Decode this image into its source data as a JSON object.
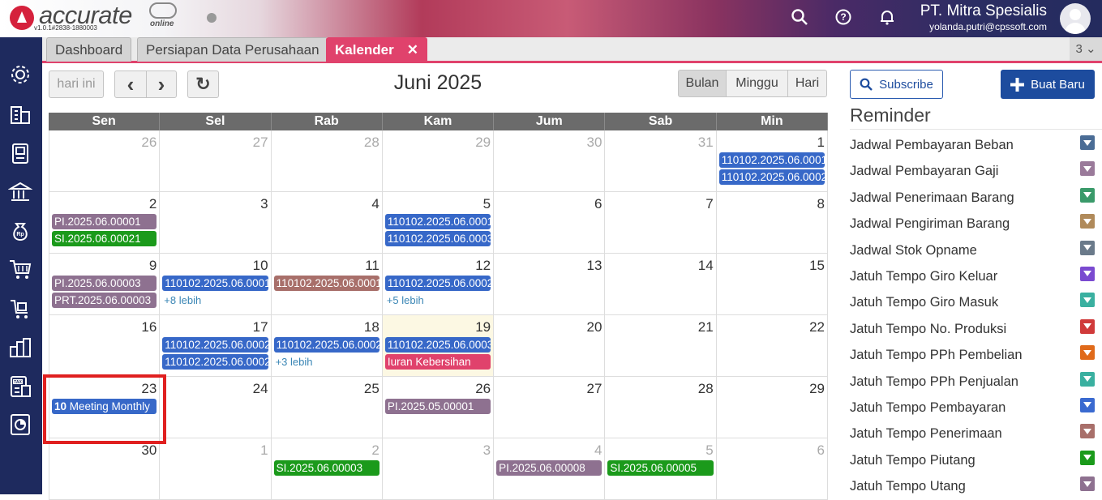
{
  "app": {
    "brand": "accurate",
    "brand_sub": "online",
    "version": "v1.0.1#2838-1880003",
    "company": "PT. Mitra Spesialis",
    "user_email": "yolanda.putri@cpssoft.com",
    "icons": [
      "search-icon",
      "help-icon",
      "bell-icon"
    ]
  },
  "tabs": [
    {
      "label": "Dashboard"
    },
    {
      "label": "Persiapan Data Perusahaan"
    },
    {
      "label": "Kalender",
      "close": "✕"
    }
  ],
  "tab_count": "3 ⌄",
  "toolbar": {
    "today": "hari ini",
    "prev": "‹",
    "next": "›",
    "refresh": "↻",
    "month_title": "Juni 2025",
    "views": [
      "Bulan",
      "Minggu",
      "Hari"
    ],
    "subscribe": "Subscribe",
    "new": "Buat Baru"
  },
  "calendar": {
    "weekdays": [
      "Sen",
      "Sel",
      "Rab",
      "Kam",
      "Jum",
      "Sab",
      "Min"
    ],
    "weeks": [
      [
        {
          "d": "26",
          "other": true,
          "events": []
        },
        {
          "d": "27",
          "other": true,
          "events": []
        },
        {
          "d": "28",
          "other": true,
          "events": []
        },
        {
          "d": "29",
          "other": true,
          "events": []
        },
        {
          "d": "30",
          "other": true,
          "events": []
        },
        {
          "d": "31",
          "other": true,
          "events": []
        },
        {
          "d": "1",
          "events": [
            {
              "t": "110102.2025.06.0001",
              "c": "blue"
            },
            {
              "t": "110102.2025.06.0002",
              "c": "blue"
            }
          ]
        }
      ],
      [
        {
          "d": "2",
          "events": [
            {
              "t": "PI.2025.06.00001",
              "c": "purple"
            },
            {
              "t": "SI.2025.06.00021",
              "c": "green"
            }
          ]
        },
        {
          "d": "3",
          "events": []
        },
        {
          "d": "4",
          "events": []
        },
        {
          "d": "5",
          "events": [
            {
              "t": "110102.2025.06.0001",
              "c": "blue"
            },
            {
              "t": "110102.2025.06.0003",
              "c": "blue"
            }
          ]
        },
        {
          "d": "6",
          "events": []
        },
        {
          "d": "7",
          "events": []
        },
        {
          "d": "8",
          "events": []
        }
      ],
      [
        {
          "d": "9",
          "events": [
            {
              "t": "PI.2025.06.00003",
              "c": "purple"
            },
            {
              "t": "PRT.2025.06.00003",
              "c": "purple"
            }
          ]
        },
        {
          "d": "10",
          "events": [
            {
              "t": "110102.2025.06.0001",
              "c": "blue"
            }
          ],
          "more": "+8 lebih"
        },
        {
          "d": "11",
          "events": [
            {
              "t": "110102.2025.06.0001",
              "c": "brown"
            }
          ]
        },
        {
          "d": "12",
          "events": [
            {
              "t": "110102.2025.06.0002",
              "c": "blue"
            }
          ],
          "more": "+5 lebih"
        },
        {
          "d": "13",
          "events": []
        },
        {
          "d": "14",
          "events": []
        },
        {
          "d": "15",
          "events": []
        }
      ],
      [
        {
          "d": "16",
          "events": []
        },
        {
          "d": "17",
          "events": [
            {
              "t": "110102.2025.06.0002",
              "c": "blue"
            },
            {
              "t": "110102.2025.06.0002",
              "c": "blue"
            }
          ]
        },
        {
          "d": "18",
          "events": [
            {
              "t": "110102.2025.06.0002",
              "c": "blue"
            }
          ],
          "more": "+3 lebih"
        },
        {
          "d": "19",
          "today": true,
          "events": [
            {
              "t": "110102.2025.06.0003",
              "c": "blue"
            },
            {
              "t": "Iuran Kebersihan",
              "c": "pink"
            }
          ]
        },
        {
          "d": "20",
          "events": []
        },
        {
          "d": "21",
          "events": []
        },
        {
          "d": "22",
          "events": []
        }
      ],
      [
        {
          "d": "23",
          "events": [
            {
              "time": "10",
              "t": " Meeting Monthly",
              "c": "blue"
            }
          ]
        },
        {
          "d": "24",
          "events": []
        },
        {
          "d": "25",
          "events": []
        },
        {
          "d": "26",
          "events": [
            {
              "t": "PI.2025.05.00001",
              "c": "purple"
            }
          ]
        },
        {
          "d": "27",
          "events": []
        },
        {
          "d": "28",
          "events": []
        },
        {
          "d": "29",
          "events": []
        }
      ],
      [
        {
          "d": "30",
          "events": []
        },
        {
          "d": "1",
          "other": true,
          "events": []
        },
        {
          "d": "2",
          "other": true,
          "events": [
            {
              "t": "SI.2025.06.00003",
              "c": "green"
            }
          ]
        },
        {
          "d": "3",
          "other": true,
          "events": []
        },
        {
          "d": "4",
          "other": true,
          "events": [
            {
              "t": "PI.2025.06.00008",
              "c": "purple"
            }
          ]
        },
        {
          "d": "5",
          "other": true,
          "events": [
            {
              "t": "SI.2025.06.00005",
              "c": "green"
            }
          ]
        },
        {
          "d": "6",
          "other": true,
          "events": []
        }
      ]
    ]
  },
  "reminder": {
    "title": "Reminder",
    "items": [
      {
        "label": "Jadwal Pembayaran Beban",
        "color": "#4a6c95"
      },
      {
        "label": "Jadwal Pembayaran Gaji",
        "color": "#9a7a9a"
      },
      {
        "label": "Jadwal Penerimaan Barang",
        "color": "#3a9a6a"
      },
      {
        "label": "Jadwal Pengiriman Barang",
        "color": "#b08a5a"
      },
      {
        "label": "Jadwal Stok Opname",
        "color": "#6a7a8a"
      },
      {
        "label": "Jatuh Tempo Giro Keluar",
        "color": "#7a4ad0"
      },
      {
        "label": "Jatuh Tempo Giro Masuk",
        "color": "#3ab0a0"
      },
      {
        "label": "Jatuh Tempo No. Produksi",
        "color": "#d03a3a"
      },
      {
        "label": "Jatuh Tempo PPh Pembelian",
        "color": "#e06a1a"
      },
      {
        "label": "Jatuh Tempo PPh Penjualan",
        "color": "#3ab0a0"
      },
      {
        "label": "Jatuh Tempo Pembayaran",
        "color": "#3a6ad0"
      },
      {
        "label": "Jatuh Tempo Penerimaan",
        "color": "#a86f6a"
      },
      {
        "label": "Jatuh Tempo Piutang",
        "color": "#1a9a1a"
      },
      {
        "label": "Jatuh Tempo Utang",
        "color": "#8e7190"
      }
    ]
  },
  "sidebar_icons": [
    "settings-icon",
    "company-icon",
    "ledger-icon",
    "bank-icon",
    "money-bag-icon",
    "purchase-cart-icon",
    "sales-cart-icon",
    "inventory-icon",
    "tax-icon",
    "report-icon"
  ]
}
